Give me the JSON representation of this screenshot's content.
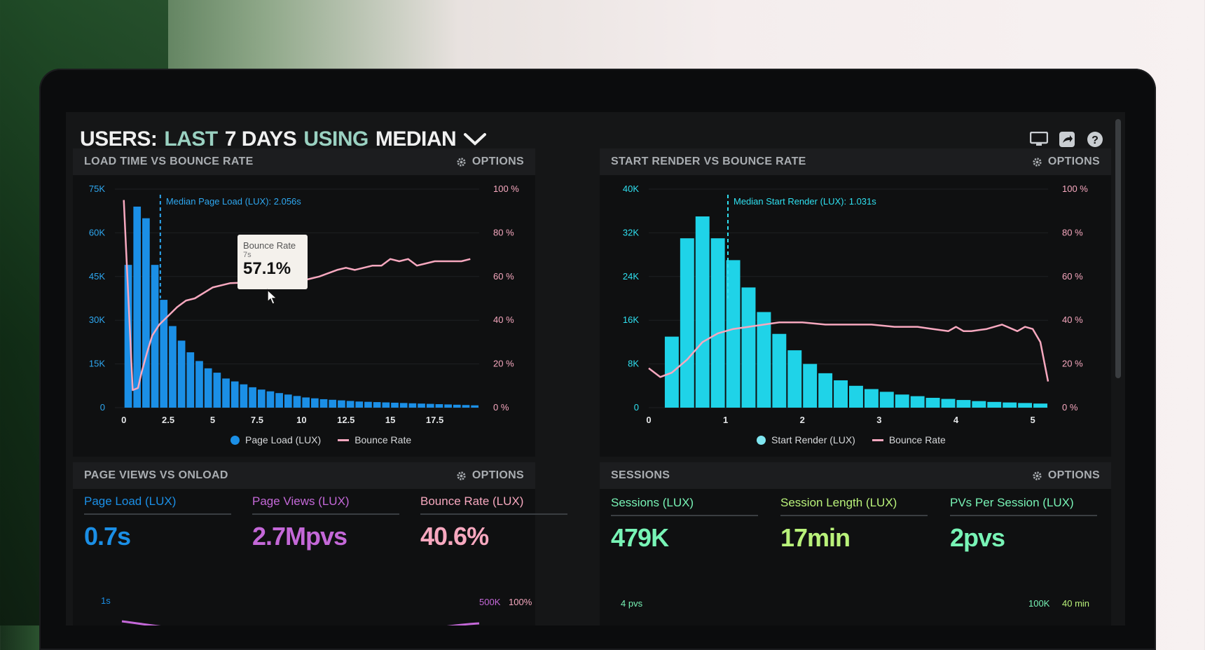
{
  "header": {
    "users": "USERS:",
    "last": "LAST",
    "days": "7 DAYS",
    "using": "USING",
    "median": "MEDIAN"
  },
  "icons": [
    "monitor-icon",
    "share-icon",
    "help-icon",
    "gear-icon",
    "chevron-down-icon"
  ],
  "colors": {
    "blue": "#1b8fe6",
    "cyan": "#1fd3e8",
    "pink": "#f7a8bf",
    "purple": "#c468d8",
    "green": "#78f4b6",
    "lime": "#b9f27a"
  },
  "panels": {
    "load": {
      "title": "LOAD TIME VS BOUNCE RATE",
      "options": "OPTIONS",
      "median_label": "Median Page Load (LUX): 2.056s",
      "legend_bars": "Page Load (LUX)",
      "legend_line": "Bounce Rate",
      "tooltip": {
        "title": "Bounce Rate",
        "sub": "7s",
        "value": "57.1%"
      }
    },
    "render": {
      "title": "START RENDER VS BOUNCE RATE",
      "options": "OPTIONS",
      "median_label": "Median Start Render (LUX): 1.031s",
      "legend_bars": "Start Render (LUX)",
      "legend_line": "Bounce Rate"
    },
    "pageviews": {
      "title": "PAGE VIEWS VS ONLOAD",
      "options": "OPTIONS",
      "metrics": [
        {
          "label": "Page Load (LUX)",
          "value": "0.7s"
        },
        {
          "label": "Page Views (LUX)",
          "value": "2.7Mpvs"
        },
        {
          "label": "Bounce Rate (LUX)",
          "value": "40.6%"
        }
      ],
      "axis_left": "1s",
      "axis_right_a": "500K",
      "axis_right_b": "100%"
    },
    "sessions": {
      "title": "SESSIONS",
      "options": "OPTIONS",
      "metrics": [
        {
          "label": "Sessions (LUX)",
          "value": "479K"
        },
        {
          "label": "Session Length (LUX)",
          "value": "17min"
        },
        {
          "label": "PVs Per Session (LUX)",
          "value": "2pvs"
        }
      ],
      "axis_left": "4 pvs",
      "axis_right_a": "100K",
      "axis_right_b": "40 min"
    }
  },
  "chart_data": [
    {
      "type": "bar",
      "title": "LOAD TIME VS BOUNCE RATE",
      "x_ticks": [
        "0",
        "2.5",
        "5",
        "7.5",
        "10",
        "12.5",
        "15",
        "17.5"
      ],
      "y_ticks": [
        "0",
        "15K",
        "30K",
        "45K",
        "60K",
        "75K"
      ],
      "y2_ticks": [
        "0 %",
        "20 %",
        "40 %",
        "60 %",
        "80 %",
        "100 %"
      ],
      "xlim": [
        -0.5,
        20
      ],
      "ylim": [
        0,
        75000
      ],
      "y2lim": [
        0,
        100
      ],
      "median": 2.056,
      "series": [
        {
          "name": "Page Load (LUX)",
          "type": "bar",
          "bin_width": 0.5,
          "x": [
            0,
            0.5,
            1,
            1.5,
            2,
            2.5,
            3,
            3.5,
            4,
            4.5,
            5,
            5.5,
            6,
            6.5,
            7,
            7.5,
            8,
            8.5,
            9,
            9.5,
            10,
            10.5,
            11,
            11.5,
            12,
            12.5,
            13,
            13.5,
            14,
            14.5,
            15,
            15.5,
            16,
            16.5,
            17,
            17.5,
            18,
            18.5,
            19,
            19.5
          ],
          "values": [
            49000,
            69000,
            65000,
            49000,
            37000,
            28000,
            23000,
            19000,
            16000,
            13500,
            12000,
            10000,
            9000,
            8000,
            7000,
            6200,
            5600,
            5000,
            4500,
            4000,
            3500,
            3200,
            2900,
            2700,
            2500,
            2300,
            2100,
            2000,
            1900,
            1800,
            1700,
            1600,
            1500,
            1400,
            1300,
            1200,
            1100,
            1000,
            900,
            800
          ]
        },
        {
          "name": "Bounce Rate",
          "type": "line",
          "axis": "y2",
          "x": [
            0,
            0.2,
            0.5,
            0.8,
            1,
            1.3,
            1.6,
            2,
            2.5,
            3,
            3.5,
            4,
            5,
            6,
            6.5,
            7,
            7.5,
            8,
            9,
            10,
            10.5,
            11,
            12,
            12.5,
            13,
            14,
            14.5,
            15,
            15.5,
            16,
            16.5,
            17,
            17.5,
            18,
            19,
            19.5
          ],
          "values": [
            95,
            60,
            8,
            9,
            16,
            25,
            33,
            38,
            42,
            46,
            49,
            50,
            55,
            57,
            57.1,
            59,
            58,
            59,
            59,
            58,
            59,
            60,
            63,
            64,
            63,
            65,
            65,
            68,
            67,
            68,
            65,
            66,
            67,
            67,
            67,
            68
          ]
        }
      ]
    },
    {
      "type": "bar",
      "title": "START RENDER VS BOUNCE RATE",
      "x_ticks": [
        "0",
        "1",
        "2",
        "3",
        "4",
        "5"
      ],
      "y_ticks": [
        "0",
        "8K",
        "16K",
        "24K",
        "32K",
        "40K"
      ],
      "y2_ticks": [
        "0 %",
        "20 %",
        "40 %",
        "60 %",
        "80 %",
        "100 %"
      ],
      "xlim": [
        0,
        5.2
      ],
      "ylim": [
        0,
        40000
      ],
      "y2lim": [
        0,
        100
      ],
      "median": 1.031,
      "series": [
        {
          "name": "Start Render (LUX)",
          "type": "bar",
          "bin_width": 0.2,
          "x": [
            0.2,
            0.4,
            0.6,
            0.8,
            1.0,
            1.2,
            1.4,
            1.6,
            1.8,
            2.0,
            2.2,
            2.4,
            2.6,
            2.8,
            3.0,
            3.2,
            3.4,
            3.6,
            3.8,
            4.0,
            4.2,
            4.4,
            4.6,
            4.8,
            5.0
          ],
          "values": [
            13000,
            31000,
            35000,
            31000,
            27000,
            22000,
            17500,
            13500,
            10500,
            8000,
            6300,
            5000,
            4000,
            3400,
            2900,
            2400,
            2100,
            1800,
            1600,
            1400,
            1200,
            1050,
            950,
            850,
            750
          ]
        },
        {
          "name": "Bounce Rate",
          "type": "line",
          "axis": "y2",
          "x": [
            0,
            0.15,
            0.3,
            0.5,
            0.7,
            0.9,
            1.1,
            1.3,
            1.5,
            1.7,
            2,
            2.3,
            2.6,
            2.9,
            3.2,
            3.5,
            3.7,
            3.9,
            4.0,
            4.1,
            4.2,
            4.4,
            4.6,
            4.8,
            4.9,
            5.0,
            5.1,
            5.2
          ],
          "values": [
            18,
            14,
            16,
            22,
            30,
            34,
            36,
            37,
            38,
            39,
            39,
            38,
            38,
            38,
            37,
            37,
            36,
            35,
            37,
            35,
            35,
            36,
            38,
            35,
            37,
            36,
            30,
            12
          ]
        }
      ]
    }
  ]
}
